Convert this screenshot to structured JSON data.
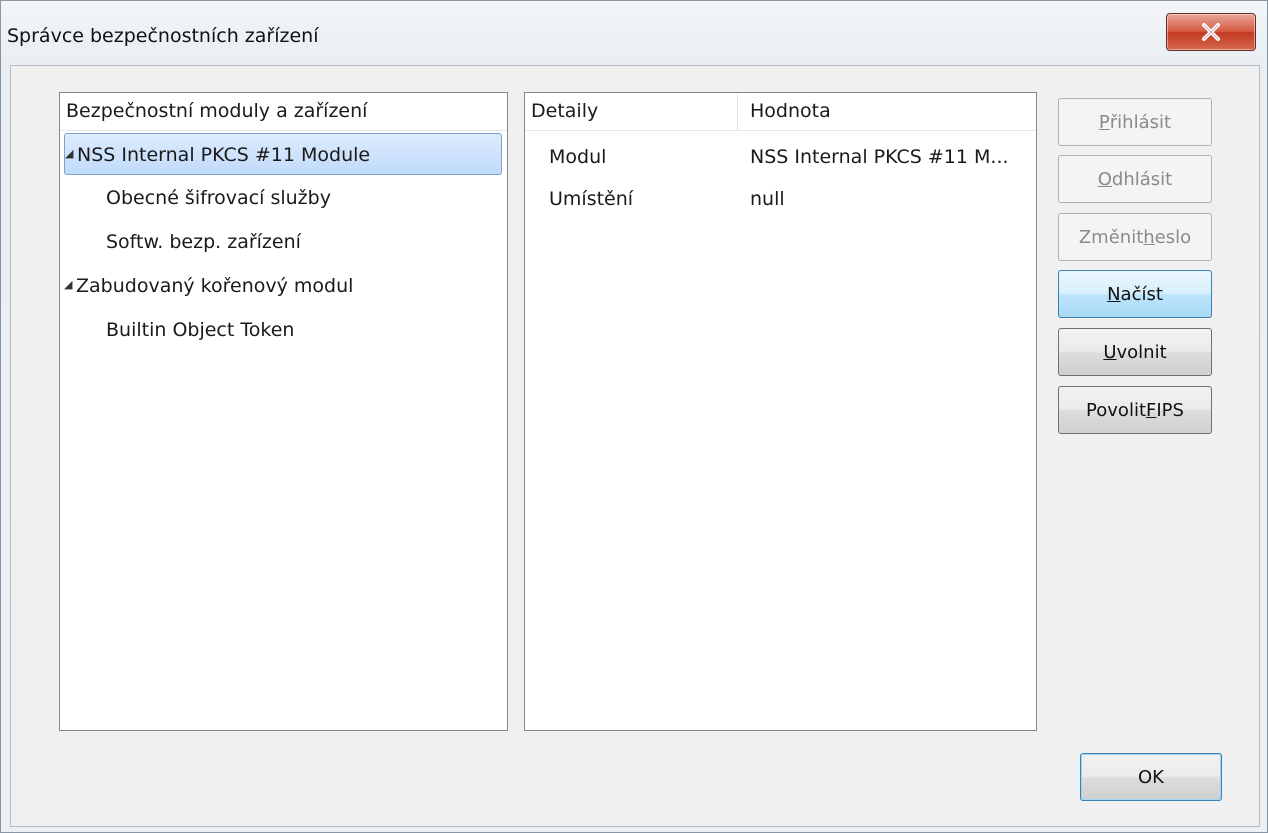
{
  "window": {
    "title": "Správce bezpečnostních zařízení"
  },
  "tree": {
    "header": "Bezpečnostní moduly a zařízení",
    "items": [
      {
        "label": "NSS Internal PKCS #11 Module",
        "expander": "◢"
      },
      {
        "label": "Obecné šifrovací služby"
      },
      {
        "label": "Softw. bezp. zařízení"
      },
      {
        "label": "Zabudovaný kořenový modul",
        "expander": "◢"
      },
      {
        "label": "Builtin Object Token"
      }
    ]
  },
  "details": {
    "headers": [
      "Detaily",
      "Hodnota"
    ],
    "rows": [
      {
        "name": "Modul",
        "value": "NSS Internal PKCS #11 M..."
      },
      {
        "name": "Umístění",
        "value": "null"
      }
    ]
  },
  "buttons": {
    "login": {
      "pre": "",
      "key": "P",
      "post": "řihlásit"
    },
    "logout": {
      "pre": "",
      "key": "O",
      "post": "dhlásit"
    },
    "change_password": {
      "pre": "Změnit ",
      "key": "h",
      "post": "eslo"
    },
    "load": {
      "pre": "",
      "key": "N",
      "post": "ačíst"
    },
    "unload": {
      "pre": "",
      "key": "U",
      "post": "volnit"
    },
    "enable_fips": {
      "pre": "Povolit ",
      "key": "F",
      "post": "IPS"
    },
    "ok": "OK"
  },
  "icons": {
    "close": "close-icon",
    "expander": "triangle-expander-icon"
  },
  "colors": {
    "selection": "#c1dbfc",
    "close_button": "#c23a22",
    "focus_border": "#3c7fb1"
  }
}
